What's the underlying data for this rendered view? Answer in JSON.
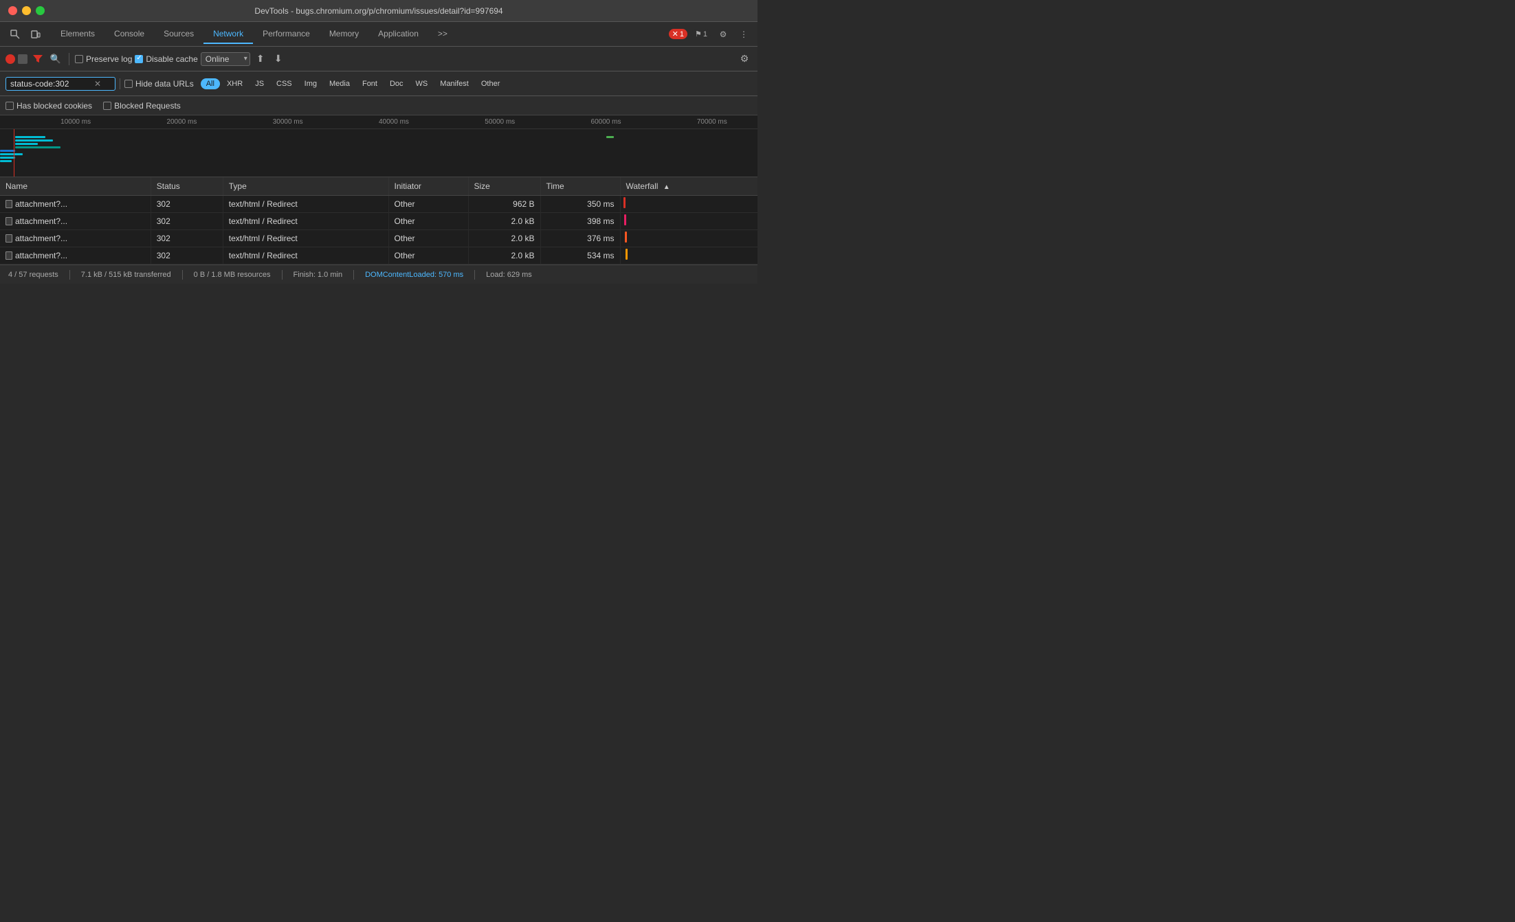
{
  "window": {
    "title": "DevTools - bugs.chromium.org/p/chromium/issues/detail?id=997694"
  },
  "tabs": {
    "items": [
      {
        "label": "Elements",
        "active": false
      },
      {
        "label": "Console",
        "active": false
      },
      {
        "label": "Sources",
        "active": false
      },
      {
        "label": "Network",
        "active": true
      },
      {
        "label": "Performance",
        "active": false
      },
      {
        "label": "Memory",
        "active": false
      },
      {
        "label": "Application",
        "active": false
      }
    ],
    "more_label": ">>",
    "error_count": "1",
    "warn_count": "1"
  },
  "toolbar": {
    "preserve_log_label": "Preserve log",
    "disable_cache_label": "Disable cache",
    "online_label": "Online"
  },
  "filter": {
    "value": "status-code:302",
    "placeholder": "Filter",
    "hide_data_urls_label": "Hide data URLs",
    "all_label": "All",
    "types": [
      "XHR",
      "JS",
      "CSS",
      "Img",
      "Media",
      "Font",
      "Doc",
      "WS",
      "Manifest",
      "Other"
    ]
  },
  "checkboxes": {
    "blocked_cookies_label": "Has blocked cookies",
    "blocked_requests_label": "Blocked Requests"
  },
  "timeline": {
    "marks": [
      "10000 ms",
      "20000 ms",
      "30000 ms",
      "40000 ms",
      "50000 ms",
      "60000 ms",
      "70000 ms"
    ]
  },
  "table": {
    "columns": [
      "Name",
      "Status",
      "Type",
      "Initiator",
      "Size",
      "Time",
      "Waterfall"
    ],
    "rows": [
      {
        "name": "attachment?...",
        "status": "302",
        "type": "text/html / Redirect",
        "initiator": "Other",
        "size": "962 B",
        "time": "350 ms"
      },
      {
        "name": "attachment?...",
        "status": "302",
        "type": "text/html / Redirect",
        "initiator": "Other",
        "size": "2.0 kB",
        "time": "398 ms"
      },
      {
        "name": "attachment?...",
        "status": "302",
        "type": "text/html / Redirect",
        "initiator": "Other",
        "size": "2.0 kB",
        "time": "376 ms"
      },
      {
        "name": "attachment?...",
        "status": "302",
        "type": "text/html / Redirect",
        "initiator": "Other",
        "size": "2.0 kB",
        "time": "534 ms"
      }
    ]
  },
  "status_bar": {
    "requests": "4 / 57 requests",
    "transferred": "7.1 kB / 515 kB transferred",
    "resources": "0 B / 1.8 MB resources",
    "finish": "Finish: 1.0 min",
    "dom_content_loaded": "DOMContentLoaded: 570 ms",
    "load": "Load: 629 ms"
  }
}
